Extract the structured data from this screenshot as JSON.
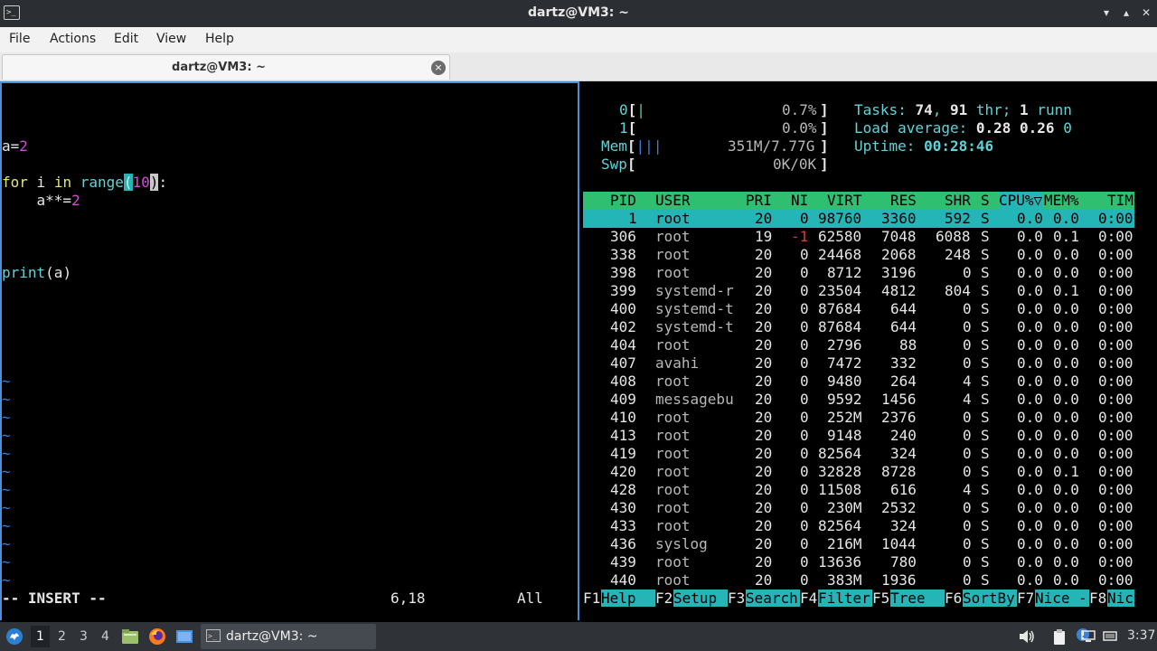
{
  "window": {
    "title": "dartz@VM3: ~",
    "icon_glyph": ">_",
    "minimize_glyph": "▾",
    "maximize_glyph": "▴",
    "close_glyph": "✕"
  },
  "menu": [
    "File",
    "Actions",
    "Edit",
    "View",
    "Help"
  ],
  "tab": {
    "label": "dartz@VM3: ~",
    "close_glyph": "×"
  },
  "vim": {
    "line_a": {
      "var": "a=",
      "num": "2"
    },
    "line_for": {
      "kw1": "for",
      "mid": " i ",
      "kw2": "in",
      "sp": " ",
      "fn": "range",
      "p_open": "(",
      "arg": "10",
      "p_close": ")",
      "colon": ":"
    },
    "line_pow": {
      "indent": "    ",
      "expr": "a**=",
      "num": "2"
    },
    "line_print": {
      "fn": "print",
      "rest": "(a)"
    },
    "tilde": "~",
    "mode": "-- INSERT --",
    "position": "6,18",
    "scroll": "All"
  },
  "htop": {
    "cpu0": {
      "label": "0",
      "open": "[",
      "bar": "|",
      "pct": "0.7%",
      "close": "]"
    },
    "cpu1": {
      "label": "1",
      "open": "[",
      "pct": "0.0%",
      "close": "]"
    },
    "mem": {
      "label": "Mem",
      "open": "[",
      "bar": "|||",
      "val": "351M/7.77G",
      "close": "]"
    },
    "swp": {
      "label": "Swp",
      "open": "[",
      "val": "0K/0K",
      "close": "]"
    },
    "tasks": {
      "label": "Tasks: ",
      "count": "74",
      "sep": ", ",
      "thr": "91",
      "thr_label": " thr; ",
      "run": "1",
      "run_label": " runn"
    },
    "load": {
      "label": "Load average: ",
      "v1": "0.28",
      "v2": "0.26",
      "v3": "0"
    },
    "uptime": {
      "label": "Uptime: ",
      "value": "00:28:46"
    },
    "header": {
      "pid": "PID",
      "user": "USER",
      "pri": "PRI",
      "ni": "NI",
      "virt": "VIRT",
      "res": "RES",
      "shr": "SHR",
      "s": "S",
      "cpu": "CPU%▽",
      "mem": "MEM%",
      "time": "TIM"
    },
    "rows": [
      {
        "pid": "1",
        "user": "root",
        "pri": "20",
        "ni": "0",
        "virt": "98760",
        "res": "3360",
        "shr": "592",
        "s": "S",
        "cpu": "0.0",
        "mem": "0.0",
        "time": "0:00"
      },
      {
        "pid": "306",
        "user": "root",
        "pri": "19",
        "ni": "-1",
        "virt": "62580",
        "res": "7048",
        "shr": "6088",
        "s": "S",
        "cpu": "0.0",
        "mem": "0.1",
        "time": "0:00"
      },
      {
        "pid": "338",
        "user": "root",
        "pri": "20",
        "ni": "0",
        "virt": "24468",
        "res": "2068",
        "shr": "248",
        "s": "S",
        "cpu": "0.0",
        "mem": "0.0",
        "time": "0:00"
      },
      {
        "pid": "398",
        "user": "root",
        "pri": "20",
        "ni": "0",
        "virt": "8712",
        "res": "3196",
        "shr": "0",
        "s": "S",
        "cpu": "0.0",
        "mem": "0.0",
        "time": "0:00"
      },
      {
        "pid": "399",
        "user": "systemd-r",
        "pri": "20",
        "ni": "0",
        "virt": "23504",
        "res": "4812",
        "shr": "804",
        "s": "S",
        "cpu": "0.0",
        "mem": "0.1",
        "time": "0:00"
      },
      {
        "pid": "400",
        "user": "systemd-t",
        "pri": "20",
        "ni": "0",
        "virt": "87684",
        "res": "644",
        "shr": "0",
        "s": "S",
        "cpu": "0.0",
        "mem": "0.0",
        "time": "0:00"
      },
      {
        "pid": "402",
        "user": "systemd-t",
        "pri": "20",
        "ni": "0",
        "virt": "87684",
        "res": "644",
        "shr": "0",
        "s": "S",
        "cpu": "0.0",
        "mem": "0.0",
        "time": "0:00"
      },
      {
        "pid": "404",
        "user": "root",
        "pri": "20",
        "ni": "0",
        "virt": "2796",
        "res": "88",
        "shr": "0",
        "s": "S",
        "cpu": "0.0",
        "mem": "0.0",
        "time": "0:00"
      },
      {
        "pid": "407",
        "user": "avahi",
        "pri": "20",
        "ni": "0",
        "virt": "7472",
        "res": "332",
        "shr": "0",
        "s": "S",
        "cpu": "0.0",
        "mem": "0.0",
        "time": "0:00"
      },
      {
        "pid": "408",
        "user": "root",
        "pri": "20",
        "ni": "0",
        "virt": "9480",
        "res": "264",
        "shr": "4",
        "s": "S",
        "cpu": "0.0",
        "mem": "0.0",
        "time": "0:00"
      },
      {
        "pid": "409",
        "user": "messagebu",
        "pri": "20",
        "ni": "0",
        "virt": "9592",
        "res": "1456",
        "shr": "4",
        "s": "S",
        "cpu": "0.0",
        "mem": "0.0",
        "time": "0:00"
      },
      {
        "pid": "410",
        "user": "root",
        "pri": "20",
        "ni": "0",
        "virt": "252M",
        "res": "2376",
        "shr": "0",
        "s": "S",
        "cpu": "0.0",
        "mem": "0.0",
        "time": "0:00"
      },
      {
        "pid": "413",
        "user": "root",
        "pri": "20",
        "ni": "0",
        "virt": "9148",
        "res": "240",
        "shr": "0",
        "s": "S",
        "cpu": "0.0",
        "mem": "0.0",
        "time": "0:00"
      },
      {
        "pid": "419",
        "user": "root",
        "pri": "20",
        "ni": "0",
        "virt": "82564",
        "res": "324",
        "shr": "0",
        "s": "S",
        "cpu": "0.0",
        "mem": "0.0",
        "time": "0:00"
      },
      {
        "pid": "420",
        "user": "root",
        "pri": "20",
        "ni": "0",
        "virt": "32828",
        "res": "8728",
        "shr": "0",
        "s": "S",
        "cpu": "0.0",
        "mem": "0.1",
        "time": "0:00"
      },
      {
        "pid": "428",
        "user": "root",
        "pri": "20",
        "ni": "0",
        "virt": "11508",
        "res": "616",
        "shr": "4",
        "s": "S",
        "cpu": "0.0",
        "mem": "0.0",
        "time": "0:00"
      },
      {
        "pid": "430",
        "user": "root",
        "pri": "20",
        "ni": "0",
        "virt": "230M",
        "res": "2532",
        "shr": "0",
        "s": "S",
        "cpu": "0.0",
        "mem": "0.0",
        "time": "0:00"
      },
      {
        "pid": "433",
        "user": "root",
        "pri": "20",
        "ni": "0",
        "virt": "82564",
        "res": "324",
        "shr": "0",
        "s": "S",
        "cpu": "0.0",
        "mem": "0.0",
        "time": "0:00"
      },
      {
        "pid": "436",
        "user": "syslog",
        "pri": "20",
        "ni": "0",
        "virt": "216M",
        "res": "1044",
        "shr": "0",
        "s": "S",
        "cpu": "0.0",
        "mem": "0.0",
        "time": "0:00"
      },
      {
        "pid": "439",
        "user": "root",
        "pri": "20",
        "ni": "0",
        "virt": "13636",
        "res": "780",
        "shr": "0",
        "s": "S",
        "cpu": "0.0",
        "mem": "0.0",
        "time": "0:00"
      },
      {
        "pid": "440",
        "user": "root",
        "pri": "20",
        "ni": "0",
        "virt": "383M",
        "res": "1936",
        "shr": "0",
        "s": "S",
        "cpu": "0.0",
        "mem": "0.0",
        "time": "0:00"
      }
    ],
    "fkeys": [
      {
        "key": "F1",
        "label": "Help"
      },
      {
        "key": "F2",
        "label": "Setup"
      },
      {
        "key": "F3",
        "label": "Search"
      },
      {
        "key": "F4",
        "label": "Filter"
      },
      {
        "key": "F5",
        "label": "Tree"
      },
      {
        "key": "F6",
        "label": "SortBy"
      },
      {
        "key": "F7",
        "label": "Nice -"
      },
      {
        "key": "F8",
        "label": "Nic"
      }
    ]
  },
  "taskbar": {
    "workspaces": [
      "1",
      "2",
      "3",
      "4"
    ],
    "task_label": "dartz@VM3: ~",
    "task_icon": ">_",
    "clock": "3:37",
    "start_icon": "start-menu-icon",
    "tray_icons": [
      "clipboard-icon",
      "volume-icon",
      "update-icon",
      "display-icon",
      "network-icon"
    ]
  },
  "colors": {
    "accent_cyan": "#24b5b7",
    "header_green": "#2fbf71",
    "pane_border": "#4a90d9"
  }
}
